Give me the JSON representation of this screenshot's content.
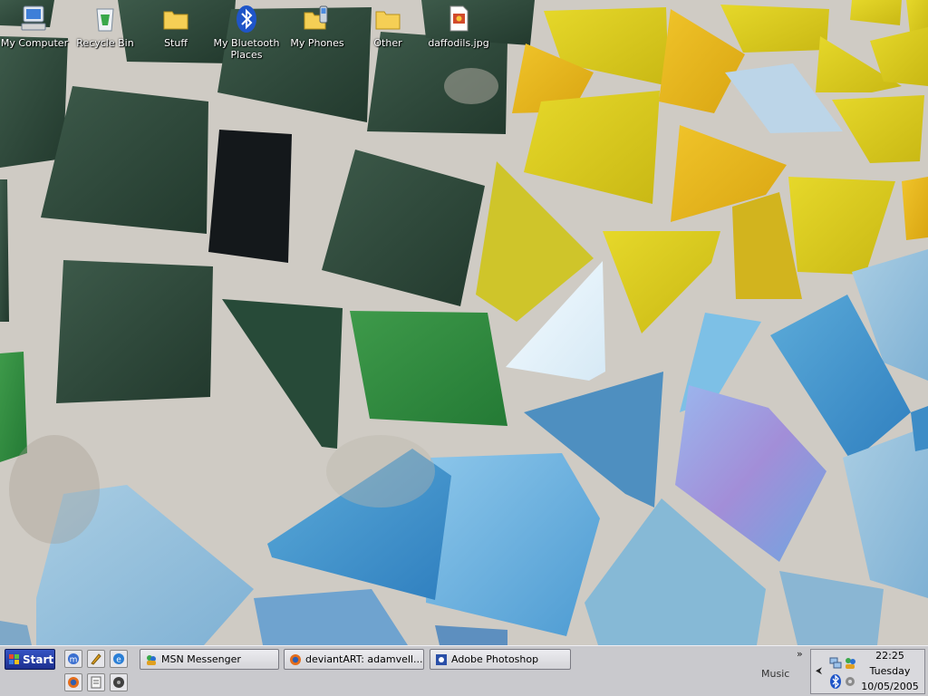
{
  "desktop": {
    "icons": [
      {
        "label": "My Computer",
        "icon": "computer-icon"
      },
      {
        "label": "Recycle Bin",
        "icon": "recycle-bin-icon"
      },
      {
        "label": "Stuff",
        "icon": "folder-icon"
      },
      {
        "label": "My Bluetooth Places",
        "icon": "bluetooth-icon"
      },
      {
        "label": "My Phones",
        "icon": "phones-folder-icon"
      },
      {
        "label": "Other",
        "icon": "folder-icon"
      },
      {
        "label": "daffodils.jpg",
        "icon": "image-file-icon"
      }
    ]
  },
  "taskbar": {
    "start_label": "Start",
    "quick_launch": [
      {
        "name": "messenger-launch-icon",
        "color": "#3a6fd0"
      },
      {
        "name": "pencil-launch-icon",
        "color": "#e0a020"
      },
      {
        "name": "internet-explorer-launch-icon",
        "color": "#2a7fd6"
      },
      {
        "name": "firefox-launch-icon",
        "color": "#e46d1b"
      },
      {
        "name": "notepad-launch-icon",
        "color": "#f4f4f4"
      },
      {
        "name": "media-launch-icon",
        "color": "#404040"
      }
    ],
    "tasks": [
      {
        "label": "MSN Messenger",
        "icon": "msn-messenger-icon"
      },
      {
        "label": "deviantART: adamvell...",
        "icon": "firefox-icon"
      },
      {
        "label": "Adobe Photoshop",
        "icon": "photoshop-icon"
      }
    ],
    "chevron": "»",
    "music_label": "Music",
    "tray_arrow": "⮜",
    "clock": {
      "time": "22:25",
      "day": "Tuesday",
      "date": "10/05/2005"
    }
  },
  "colors": {
    "taskbar": "#c9c9cd",
    "start_button": "#2a3fae",
    "grout": "#cfcbc4"
  }
}
